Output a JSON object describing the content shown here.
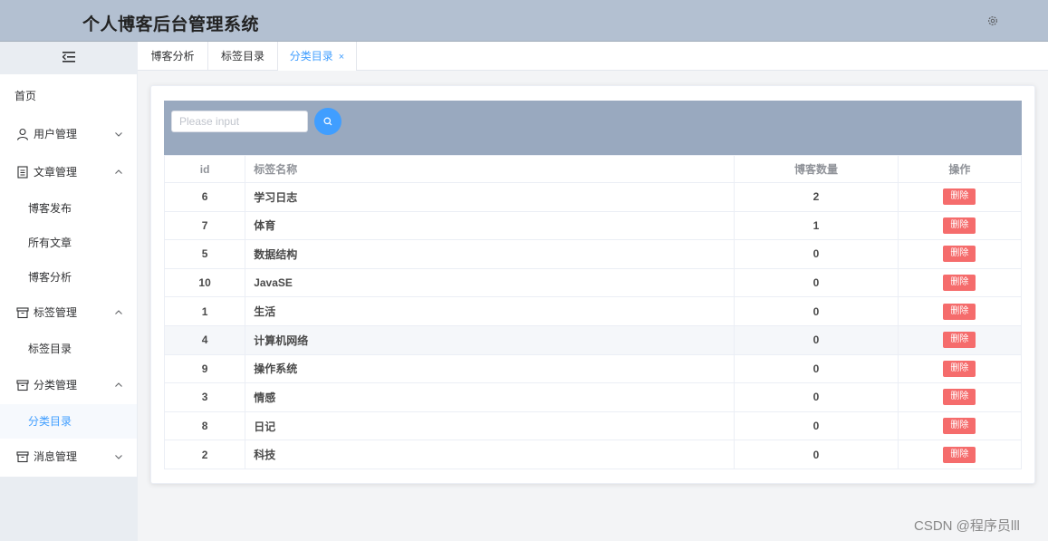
{
  "header": {
    "title": "个人博客后台管理系统",
    "settings_icon": "gear-icon"
  },
  "sidebar": {
    "home": "首页",
    "groups": [
      {
        "label": "用户管理",
        "icon": "user-icon",
        "expanded": false,
        "items": []
      },
      {
        "label": "文章管理",
        "icon": "document-icon",
        "expanded": true,
        "items": [
          "博客发布",
          "所有文章",
          "博客分析"
        ]
      },
      {
        "label": "标签管理",
        "icon": "box-icon",
        "expanded": true,
        "items": [
          "标签目录"
        ]
      },
      {
        "label": "分类管理",
        "icon": "box-icon",
        "expanded": true,
        "items": [
          "分类目录"
        ]
      },
      {
        "label": "消息管理",
        "icon": "box-icon",
        "expanded": false,
        "items": []
      }
    ],
    "active_item": "分类目录"
  },
  "tabs": [
    {
      "label": "博客分析",
      "active": false
    },
    {
      "label": "标签目录",
      "active": false
    },
    {
      "label": "分类目录",
      "active": true,
      "close": "×"
    }
  ],
  "search": {
    "placeholder": "Please input",
    "value": ""
  },
  "table": {
    "headers": [
      "id",
      "标签名称",
      "博客数量",
      "操作"
    ],
    "rows": [
      {
        "id": "6",
        "name": "学习日志",
        "count": "2",
        "action": "删除"
      },
      {
        "id": "7",
        "name": "体育",
        "count": "1",
        "action": "删除"
      },
      {
        "id": "5",
        "name": "数据结构",
        "count": "0",
        "action": "删除"
      },
      {
        "id": "10",
        "name": "JavaSE",
        "count": "0",
        "action": "删除"
      },
      {
        "id": "1",
        "name": "生活",
        "count": "0",
        "action": "删除"
      },
      {
        "id": "4",
        "name": "计算机网络",
        "count": "0",
        "action": "删除"
      },
      {
        "id": "9",
        "name": "操作系统",
        "count": "0",
        "action": "删除"
      },
      {
        "id": "3",
        "name": "情感",
        "count": "0",
        "action": "删除"
      },
      {
        "id": "8",
        "name": "日记",
        "count": "0",
        "action": "删除"
      },
      {
        "id": "2",
        "name": "科技",
        "count": "0",
        "action": "删除"
      }
    ],
    "highlighted_row": 5
  },
  "watermark": "CSDN @程序员lll",
  "colors": {
    "header_bg": "#b3c0d1",
    "toolbar_bg": "#99a9bf",
    "primary": "#409eff",
    "danger": "#f56c6c"
  }
}
